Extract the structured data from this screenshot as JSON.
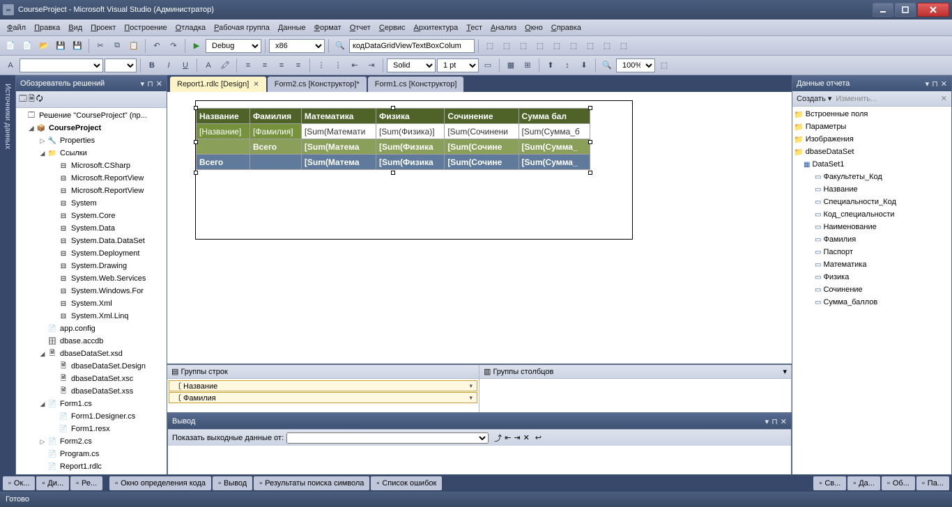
{
  "title": "CourseProject - Microsoft Visual Studio (Администратор)",
  "menu": [
    "Файл",
    "Правка",
    "Вид",
    "Проект",
    "Построение",
    "Отладка",
    "Рабочая группа",
    "Данные",
    "Формат",
    "Отчет",
    "Сервис",
    "Архитектура",
    "Тест",
    "Анализ",
    "Окно",
    "Справка"
  ],
  "toolbar1": {
    "config": "Debug",
    "platform": "x86",
    "find": "кодDataGridViewTextBoxColum"
  },
  "toolbar2": {
    "style": "Solid",
    "width": "1 pt",
    "zoom": "100%"
  },
  "solution": {
    "title": "Обозреватель решений",
    "root": "Решение \"CourseProject\"  (пр...",
    "project": "CourseProject",
    "nodes": {
      "properties": "Properties",
      "refs": "Ссылки",
      "ref_items": [
        "Microsoft.CSharp",
        "Microsoft.ReportView",
        "Microsoft.ReportView",
        "System",
        "System.Core",
        "System.Data",
        "System.Data.DataSet",
        "System.Deployment",
        "System.Drawing",
        "System.Web.Services",
        "System.Windows.For",
        "System.Xml",
        "System.Xml.Linq"
      ],
      "appconfig": "app.config",
      "dbase": "dbase.accdb",
      "dataset": "dbaseDataSet.xsd",
      "dataset_items": [
        "dbaseDataSet.Design",
        "dbaseDataSet.xsc",
        "dbaseDataSet.xss"
      ],
      "form1": "Form1.cs",
      "form1_items": [
        "Form1.Designer.cs",
        "Form1.resx"
      ],
      "form2": "Form2.cs",
      "program": "Program.cs",
      "report": "Report1.rdlc"
    }
  },
  "side_tab": "Источники данных",
  "doc_tabs": [
    {
      "label": "Report1.rdlc [Design]",
      "active": true,
      "closable": true
    },
    {
      "label": "Form2.cs [Конструктор]*",
      "active": false,
      "closable": false
    },
    {
      "label": "Form1.cs [Конструктор]",
      "active": false,
      "closable": false
    }
  ],
  "tablix": {
    "headers": [
      "Название",
      "Фамилия",
      "Математика",
      "Физика",
      "Сочинение",
      "Сумма бал"
    ],
    "data": [
      "[Название]",
      "[Фамилия]",
      "[Sum(Математи",
      "[Sum(Физика)]",
      "[Sum(Сочинени",
      "[Sum(Сумма_б"
    ],
    "sub": [
      "",
      "Всего",
      "[Sum(Матема",
      "[Sum(Физика",
      "[Sum(Сочине",
      "[Sum(Сумма_"
    ],
    "tot": [
      "Всего",
      "",
      "[Sum(Матема",
      "[Sum(Физика",
      "[Sum(Сочине",
      "[Sum(Сумма_"
    ]
  },
  "groups": {
    "rows_title": "Группы строк",
    "cols_title": "Группы столбцов",
    "rows": [
      "Название",
      "Фамилия"
    ]
  },
  "output": {
    "title": "Вывод",
    "show_label": "Показать выходные данные от:"
  },
  "report_data": {
    "title": "Данные отчета",
    "create": "Создать",
    "edit": "Изменить...",
    "folders": [
      "Встроенные поля",
      "Параметры",
      "Изображения",
      "dbaseDataSet"
    ],
    "dataset": "DataSet1",
    "fields": [
      "Факультеты_Код",
      "Название",
      "Специальности_Код",
      "Код_специальности",
      "Наименование",
      "Фамилия",
      "Паспорт",
      "Математика",
      "Физика",
      "Сочинение",
      "Сумма_баллов"
    ]
  },
  "bottom_tabs_left": [
    "Ок...",
    "Ди...",
    "Ре..."
  ],
  "bottom_tabs_center": [
    "Окно определения кода",
    "Вывод",
    "Результаты поиска символа",
    "Список ошибок"
  ],
  "bottom_tabs_right": [
    "Св...",
    "Да...",
    "Об...",
    "Па..."
  ],
  "status": "Готово"
}
